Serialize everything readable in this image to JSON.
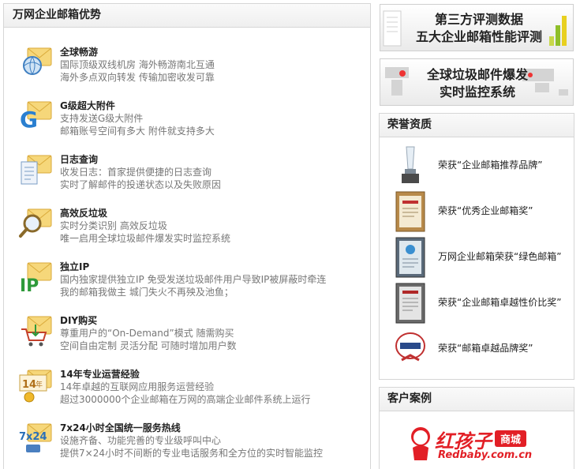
{
  "left": {
    "title": "万网企业邮箱优势",
    "features": [
      {
        "icon": "globe-roaming-icon",
        "title": "全球畅游",
        "line1": "国际顶级双线机房 海外畅游南北互通",
        "line2": "海外多点双向转发 传输加密收发可靠"
      },
      {
        "icon": "g-attachment-icon",
        "title": "G级超大附件",
        "line1": "支持发送G级大附件",
        "line2": "邮箱账号空间有多大 附件就支持多大"
      },
      {
        "icon": "log-document-icon",
        "title": "日志查询",
        "line1": "收发日志：首家提供便捷的日志查询",
        "line2": "实时了解邮件的投递状态以及失败原因"
      },
      {
        "icon": "magnifier-icon",
        "title": "高效反垃圾",
        "line1": "实时分类识别 高效反垃圾",
        "line2": "唯一启用全球垃圾邮件爆发实时监控系统"
      },
      {
        "icon": "ip-icon",
        "title": "独立IP",
        "line1": "国内独家提供独立IP 免受发送垃圾邮件用户导致IP被屏蔽时牵连",
        "line2": "我的邮箱我做主 城门失火不再殃及池鱼；"
      },
      {
        "icon": "shopping-cart-icon",
        "title": "DIY购买",
        "line1": "尊重用户的“On-Demand”模式 随需购买",
        "line2": "空间自由定制 灵活分配 可随时增加用户数"
      },
      {
        "icon": "14-years-medal-icon",
        "title": "14年专业运营经验",
        "line1": "14年卓越的互联网应用服务运营经验",
        "line2": "超过3000000个企业邮箱在万网的高端企业邮件系统上运行"
      },
      {
        "icon": "7x24-phone-icon",
        "title": "7x24小时全国统一服务热线",
        "line1": "设施齐备、功能完善的专业级呼叫中心",
        "line2": "提供7×24小时不间断的专业电话服务和全方位的实时智能监控"
      }
    ]
  },
  "banners": [
    {
      "line1": "第三方评测数据",
      "line2": "五大企业邮箱性能评测"
    },
    {
      "line1": "全球垃圾邮件爆发",
      "line2": "实时监控系统"
    }
  ],
  "honors": {
    "title": "荣誉资质",
    "items": [
      {
        "icon": "crystal-trophy-icon",
        "text": "荣获“企业邮箱推荐品牌”"
      },
      {
        "icon": "award-plaque-icon",
        "text": "荣获“优秀企业邮箱奖”"
      },
      {
        "icon": "green-certificate-icon",
        "text": "万网企业邮箱荣获“绿色邮箱”"
      },
      {
        "icon": "value-certificate-icon",
        "text": "荣获“企业邮箱卓越性价比奖”"
      },
      {
        "icon": "brand-badge-icon",
        "text": "荣获“邮箱卓越品牌奖”"
      }
    ]
  },
  "cases": {
    "title": "客户案例",
    "logo_brand": "红孩子",
    "logo_tag": "商城",
    "logo_domain": "Redbaby.com.cn"
  },
  "colors": {
    "brand_red": "#e21f26",
    "envelope": "#f6d77a",
    "border": "#d6d6d6"
  }
}
